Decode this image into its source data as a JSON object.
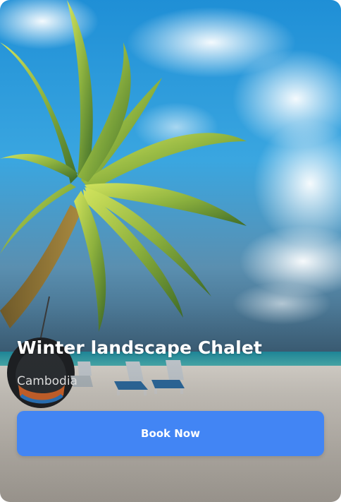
{
  "card": {
    "title": "Winter landscape Chalet",
    "location": "Cambodia",
    "book_label": "Book Now"
  },
  "colors": {
    "accent": "#4285f4",
    "title_text": "#ffffff",
    "location_text": "#dcdcdc"
  },
  "image": {
    "icon": "tropical-beach-photo"
  }
}
